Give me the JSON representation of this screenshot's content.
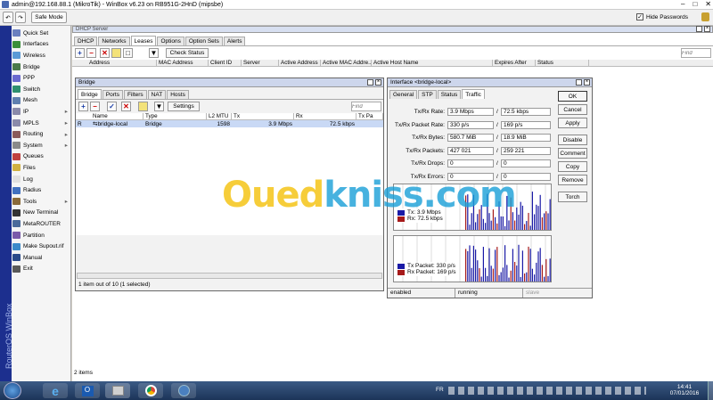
{
  "window": {
    "title": "admin@192.168.88.1 (MikroTik) - WinBox v6.23 on RB951G-2HnD (mipsbe)",
    "minimize": "–",
    "maximize": "□",
    "close": "✕"
  },
  "toolbar": {
    "undo": "↶",
    "redo": "↷",
    "safe_mode": "Safe Mode",
    "hide_passwords": "Hide Passwords"
  },
  "sidebar": {
    "brand": "RouterOS WinBox",
    "items": [
      {
        "label": "Quick Set",
        "icon": "quickset-icon",
        "color": "#6a7fbf"
      },
      {
        "label": "Interfaces",
        "icon": "interfaces-icon",
        "color": "#3a8f3a"
      },
      {
        "label": "Wireless",
        "icon": "wireless-icon",
        "color": "#5a9ad6"
      },
      {
        "label": "Bridge",
        "icon": "bridge-icon",
        "color": "#4a7a4a"
      },
      {
        "label": "PPP",
        "icon": "ppp-icon",
        "color": "#6a6acf"
      },
      {
        "label": "Switch",
        "icon": "switch-icon",
        "color": "#2f8f6f"
      },
      {
        "label": "Mesh",
        "icon": "mesh-icon",
        "color": "#5f7faf"
      },
      {
        "label": "IP",
        "icon": "ip-icon",
        "color": "#8a8aaa",
        "arrow": "▸"
      },
      {
        "label": "MPLS",
        "icon": "mpls-icon",
        "color": "#8a8aaa",
        "arrow": "▸"
      },
      {
        "label": "Routing",
        "icon": "routing-icon",
        "color": "#8a5a5a",
        "arrow": "▸"
      },
      {
        "label": "System",
        "icon": "system-icon",
        "color": "#8a8a8a",
        "arrow": "▸"
      },
      {
        "label": "Queues",
        "icon": "queues-icon",
        "color": "#c04040"
      },
      {
        "label": "Files",
        "icon": "files-icon",
        "color": "#d0b040"
      },
      {
        "label": "Log",
        "icon": "log-icon",
        "color": "#e0e0e0"
      },
      {
        "label": "Radius",
        "icon": "radius-icon",
        "color": "#4070c0"
      },
      {
        "label": "Tools",
        "icon": "tools-icon",
        "color": "#8a6a3a",
        "arrow": "▸"
      },
      {
        "label": "New Terminal",
        "icon": "terminal-icon",
        "color": "#333333"
      },
      {
        "label": "MetaROUTER",
        "icon": "metarouter-icon",
        "color": "#4a6a9a"
      },
      {
        "label": "Partition",
        "icon": "partition-icon",
        "color": "#7a5aaa"
      },
      {
        "label": "Make Supout.rif",
        "icon": "supout-icon",
        "color": "#3a8aca"
      },
      {
        "label": "Manual",
        "icon": "manual-icon",
        "color": "#2a4a8a"
      },
      {
        "label": "Exit",
        "icon": "exit-icon",
        "color": "#5a5a5a"
      }
    ]
  },
  "dhcp": {
    "title": "DHCP Server",
    "tabs": [
      "DHCP",
      "Networks",
      "Leases",
      "Options",
      "Option Sets",
      "Alerts"
    ],
    "active_tab": "Leases",
    "check_status": "Check Status",
    "find_placeholder": "Find",
    "columns": [
      "Address",
      "MAC Address",
      "Client ID",
      "Server",
      "Active Address",
      "Active MAC Addre...",
      "Active Host Name",
      "Expires After",
      "Status"
    ],
    "status_bar": "2 items"
  },
  "bridge": {
    "title": "Bridge",
    "tabs": [
      "Bridge",
      "Ports",
      "Filters",
      "NAT",
      "Hosts"
    ],
    "active_tab": "Bridge",
    "settings": "Settings",
    "find_placeholder": "Find",
    "columns": [
      "",
      "Name",
      "Type",
      "L2 MTU",
      "Tx",
      "Rx",
      "Tx Pa"
    ],
    "rows": [
      {
        "flag": "R",
        "name": "⇆bridge-local",
        "type": "Bridge",
        "l2mtu": "1598",
        "tx": "3.9 Mbps",
        "rx": "72.5 kbps"
      }
    ],
    "status_bar": "1 item out of 10 (1 selected)"
  },
  "iface": {
    "title": "Interface <bridge-local>",
    "tabs": [
      "General",
      "STP",
      "Status",
      "Traffic"
    ],
    "active_tab": "Traffic",
    "stats": [
      {
        "label": "Tx/Rx Rate:",
        "tx": "3.9 Mbps",
        "rx": "72.5 kbps"
      },
      {
        "label": "Tx/Rx Packet Rate:",
        "tx": "330 p/s",
        "rx": "169 p/s"
      },
      {
        "label": "Tx/Rx Bytes:",
        "tx": "580.7 MiB",
        "rx": "18.9 MiB"
      },
      {
        "label": "Tx/Rx Packets:",
        "tx": "427 021",
        "rx": "259 221"
      },
      {
        "label": "Tx/Rx Drops:",
        "tx": "0",
        "rx": "0"
      },
      {
        "label": "Tx/Rx Errors:",
        "tx": "0",
        "rx": "0"
      }
    ],
    "separator": "/",
    "buttons": [
      "OK",
      "Cancel",
      "Apply",
      "Disable",
      "Comment",
      "Copy",
      "Remove",
      "Torch"
    ],
    "legend1": {
      "tx": "Tx:   3.9 Mbps",
      "rx": "Rx:   72.5 kbps"
    },
    "legend2": {
      "tx": "Tx Packet:  330 p/s",
      "rx": "Rx Packet:  169 p/s"
    },
    "status": [
      "enabled",
      "running",
      "slave"
    ]
  },
  "watermark": {
    "part1": "Oued",
    "part2": "kniss",
    ".com": ".com"
  },
  "taskbar": {
    "lang": "FR",
    "time": "14:41",
    "date": "07/01/2016"
  }
}
